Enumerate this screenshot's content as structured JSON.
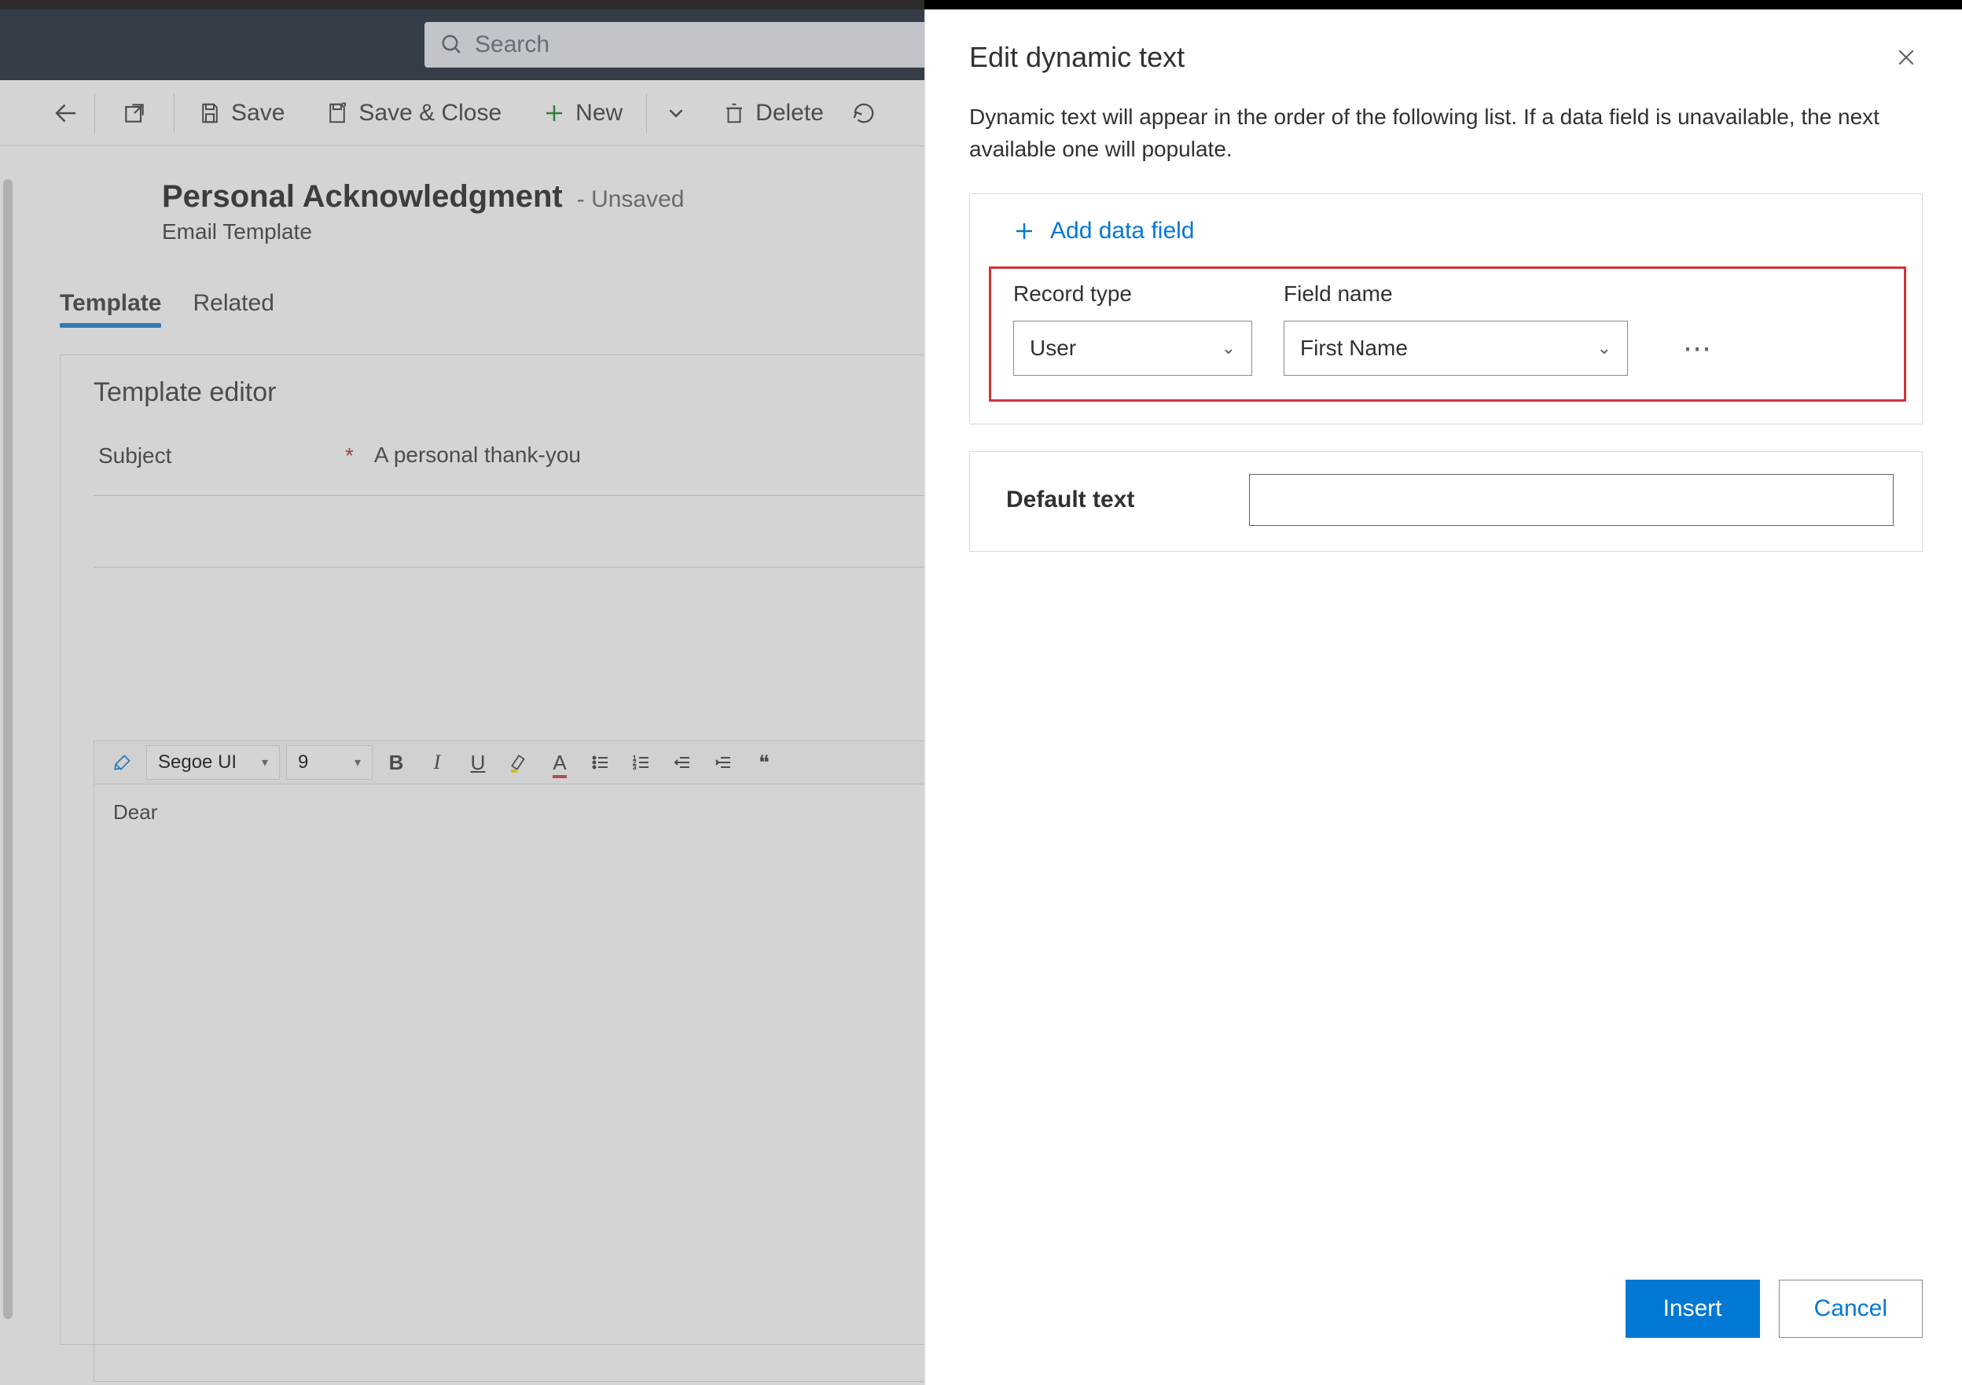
{
  "search": {
    "placeholder": "Search"
  },
  "commands": {
    "save": "Save",
    "save_close": "Save & Close",
    "new": "New",
    "delete": "Delete"
  },
  "page": {
    "title": "Personal Acknowledgment",
    "status": "- Unsaved",
    "subtitle": "Email Template"
  },
  "tabs": {
    "template": "Template",
    "related": "Related"
  },
  "editor": {
    "heading": "Template editor",
    "subject_label": "Subject",
    "subject_value": "A personal thank-you",
    "font_name": "Segoe UI",
    "font_size": "9",
    "body": "Dear"
  },
  "panel": {
    "title": "Edit dynamic text",
    "description": "Dynamic text will appear in the order of the following list. If a data field is unavailable, the next available one will populate.",
    "add_field": "Add data field",
    "record_type_label": "Record type",
    "field_name_label": "Field name",
    "record_type_value": "User",
    "field_name_value": "First Name",
    "default_text_label": "Default text",
    "default_text_value": "",
    "insert": "Insert",
    "cancel": "Cancel"
  }
}
